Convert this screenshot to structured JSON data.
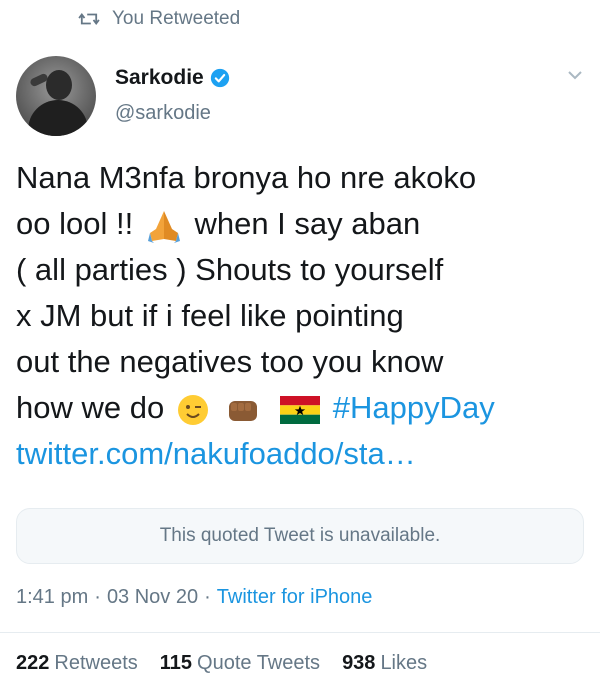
{
  "retweet_banner": {
    "text": "You Retweeted",
    "icon": "retweet-icon"
  },
  "author": {
    "name": "Sarkodie",
    "handle": "@sarkodie",
    "verified": true,
    "avatar": "avatar-photo"
  },
  "tweet": {
    "lines": [
      "Nana M3nfa bronya ho nre akoko",
      "oo lool !!",
      "when I say aban",
      "( all parties ) Shouts to yourself",
      "x JM but if i feel like pointing",
      "out the negatives too you know",
      "how we do",
      "#HappyDay",
      "twitter.com/nakufoaddo/sta…"
    ],
    "emojis": [
      "folded-hands-emoji",
      "winking-face-emoji",
      "fist-bump-emoji",
      "ghana-flag-emoji"
    ]
  },
  "quoted_tweet": {
    "text": "This quoted Tweet is unavailable."
  },
  "meta": {
    "time": "1:41 pm",
    "sep1": "·",
    "date": "03 Nov 20",
    "sep2": "·",
    "source": "Twitter for iPhone"
  },
  "stats": {
    "retweets_count": "222",
    "retweets_label": "Retweets",
    "quotes_count": "115",
    "quotes_label": "Quote Tweets",
    "likes_count": "938",
    "likes_label": "Likes"
  },
  "colors": {
    "accent": "#1b95e0",
    "muted": "#657786",
    "text": "#14171a",
    "verified": "#1da1f2"
  }
}
